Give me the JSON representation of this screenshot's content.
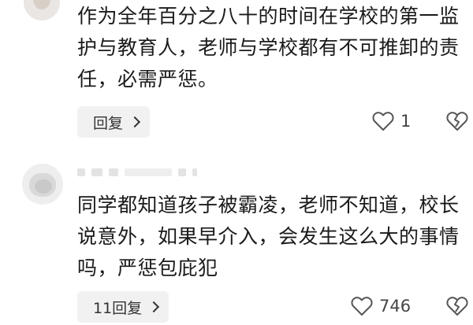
{
  "comments": [
    {
      "text": "作为全年百分之八十的时间在学校的第一监护与教育人，老师与学校都有不可推卸的责任，必需严惩。",
      "reply_label": "回复",
      "like_count": "1"
    },
    {
      "text": "同学都知道孩子被霸凌，老师不知道，校长说意外，如果早介入，会发生这么大的事情吗，严惩包庇犯",
      "reply_label": "11回复",
      "like_count": "746"
    }
  ],
  "icons": {
    "like": "heart-outline-icon",
    "dislike": "broken-heart-icon",
    "reply_arrow": "chevron-right-icon"
  },
  "colors": {
    "text": "#1a1a1a",
    "button_bg": "#f1f1f1",
    "icon": "#555555"
  }
}
